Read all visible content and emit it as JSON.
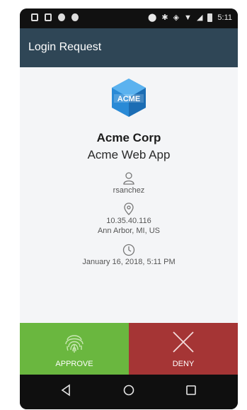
{
  "status_bar": {
    "time": "5:11"
  },
  "header": {
    "title": "Login Request"
  },
  "request": {
    "logo_text": "ACME",
    "organization": "Acme Corp",
    "application": "Acme Web App",
    "username": "rsanchez",
    "ip_address": "10.35.40.116",
    "location": "Ann Arbor, MI, US",
    "timestamp": "January 16, 2018, 5:11 PM"
  },
  "actions": {
    "approve_label": "APPROVE",
    "deny_label": "DENY"
  },
  "colors": {
    "header": "#2f4656",
    "approve": "#6ab73f",
    "deny": "#a53535",
    "logo": "#2a8ad6"
  }
}
